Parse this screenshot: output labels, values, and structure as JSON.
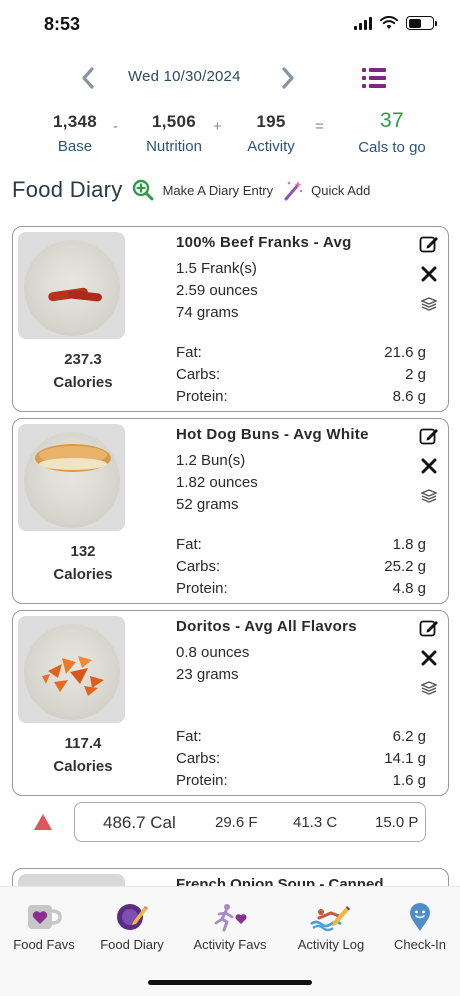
{
  "status": {
    "time": "8:53",
    "battery_level": 0.55
  },
  "header": {
    "date": "Wed 10/30/2024"
  },
  "summary": {
    "base": {
      "value": "1,348",
      "label": "Base"
    },
    "op1": "-",
    "nutrition": {
      "value": "1,506",
      "label": "Nutrition"
    },
    "op2": "+",
    "activity": {
      "value": "195",
      "label": "Activity"
    },
    "op3": "=",
    "goal": {
      "value": "37",
      "label": "Cals to go",
      "color": "#2f9a46"
    }
  },
  "diary": {
    "title": "Food Diary",
    "make_entry": "Make A Diary Entry",
    "quick_add": "Quick Add"
  },
  "entries": [
    {
      "name": "100% Beef Franks - Avg",
      "lines": [
        "1.5 Frank(s)",
        "2.59 ounces",
        "74 grams"
      ],
      "calories": "237.3",
      "calories_label": "Calories",
      "fat_label": "Fat:",
      "fat": "21.6 g",
      "carbs_label": "Carbs:",
      "carbs": "2 g",
      "protein_label": "Protein:",
      "protein": "8.6 g"
    },
    {
      "name": "Hot Dog Buns - Avg White",
      "lines": [
        "1.2 Bun(s)",
        "1.82 ounces",
        "52 grams"
      ],
      "calories": "132",
      "calories_label": "Calories",
      "fat_label": "Fat:",
      "fat": "1.8 g",
      "carbs_label": "Carbs:",
      "carbs": "25.2 g",
      "protein_label": "Protein:",
      "protein": "4.8 g"
    },
    {
      "name": "Doritos - Avg All Flavors",
      "lines": [
        "0.8 ounces",
        "23 grams"
      ],
      "calories": "117.4",
      "calories_label": "Calories",
      "fat_label": "Fat:",
      "fat": "6.2 g",
      "carbs_label": "Carbs:",
      "carbs": "14.1 g",
      "protein_label": "Protein:",
      "protein": "1.6 g"
    }
  ],
  "totals": {
    "calories": "486.7 Cal",
    "fat": "29.6 F",
    "carbs": "41.3 C",
    "protein": "15.0 P",
    "warning_color": "#e0545e"
  },
  "partial_entry": {
    "name": "French Onion Soup - Canned"
  },
  "tabs": [
    {
      "label": "Food Favs",
      "icon": "heart-mug-icon"
    },
    {
      "label": "Food Diary",
      "icon": "plate-pencil-icon"
    },
    {
      "label": "Activity Favs",
      "icon": "runner-heart-icon"
    },
    {
      "label": "Activity Log",
      "icon": "swimmer-pencil-icon"
    },
    {
      "label": "Check-In",
      "icon": "location-pin-icon"
    }
  ]
}
